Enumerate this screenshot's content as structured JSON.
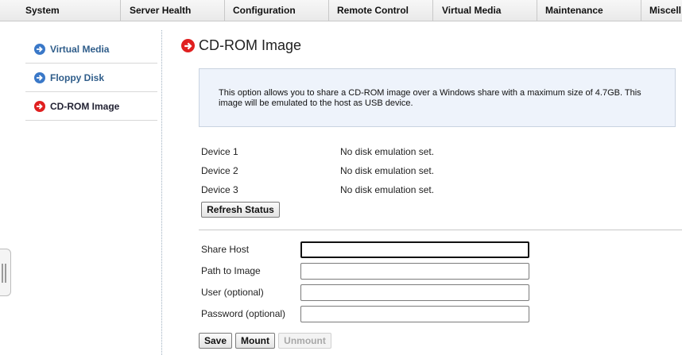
{
  "nav": {
    "items": [
      "System",
      "Server Health",
      "Configuration",
      "Remote Control",
      "Virtual Media",
      "Maintenance",
      "Miscell"
    ]
  },
  "sidebar": {
    "items": [
      {
        "label": "Virtual Media",
        "icon": "arrow-right-icon",
        "color": "#3a78c8"
      },
      {
        "label": "Floppy Disk",
        "icon": "arrow-right-icon",
        "color": "#3a78c8"
      },
      {
        "label": "CD-ROM Image",
        "icon": "arrow-right-icon",
        "color": "#e02020",
        "active": true
      }
    ]
  },
  "page": {
    "title": "CD-ROM Image",
    "title_icon": "arrow-right-icon",
    "title_icon_color": "#e02020",
    "info": "This option allows you to share a CD-ROM image over a Windows share with a maximum size of 4.7GB. This image will be emulated to the host as USB device."
  },
  "devices": [
    {
      "label": "Device 1",
      "status": "No disk emulation set."
    },
    {
      "label": "Device 2",
      "status": "No disk emulation set."
    },
    {
      "label": "Device 3",
      "status": "No disk emulation set."
    }
  ],
  "buttons": {
    "refresh": "Refresh Status",
    "save": "Save",
    "mount": "Mount",
    "unmount": "Unmount"
  },
  "form": {
    "share_host": {
      "label": "Share Host",
      "value": ""
    },
    "path": {
      "label": "Path to Image",
      "value": ""
    },
    "user": {
      "label": "User (optional)",
      "value": ""
    },
    "password": {
      "label": "Password (optional)",
      "value": ""
    }
  }
}
